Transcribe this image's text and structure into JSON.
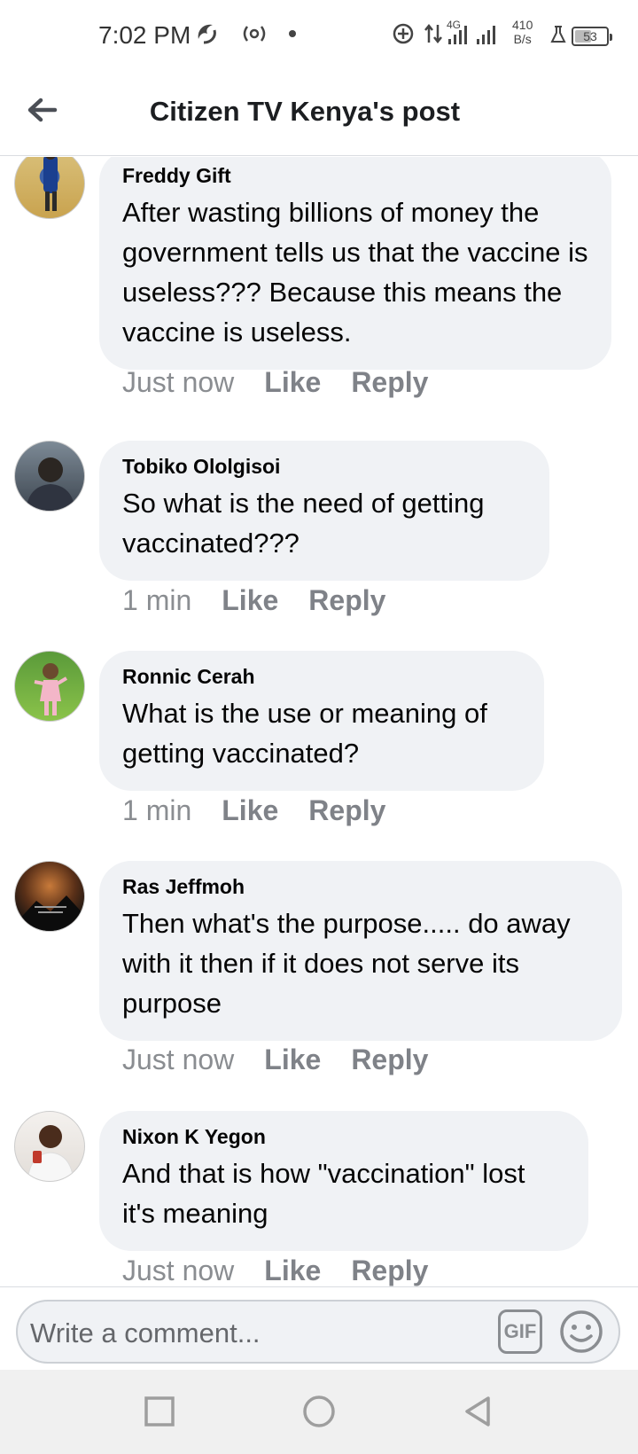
{
  "status_bar": {
    "time": "7:02 PM",
    "network_label": "4G",
    "speed_value": "410",
    "speed_unit": "B/s",
    "battery": "53",
    "battery_fraction": 0.53
  },
  "header": {
    "title": "Citizen TV Kenya's post"
  },
  "comments": [
    {
      "author": "Freddy Gift",
      "text": "After wasting billions of money the government tells us that the vaccine is useless??? Because this means the vaccine is useless.",
      "time": "Just now",
      "like_label": "Like",
      "reply_label": "Reply"
    },
    {
      "author": "Tobiko Ololgisoi",
      "text": "So what is the need of getting vaccinated???",
      "time": "1 min",
      "like_label": "Like",
      "reply_label": "Reply"
    },
    {
      "author": "Ronnic Cerah",
      "text": "What is the use or meaning of getting vaccinated?",
      "time": "1 min",
      "like_label": "Like",
      "reply_label": "Reply"
    },
    {
      "author": "Ras Jeffmoh",
      "text": "Then what's the purpose..... do away with it then if it does not serve its purpose",
      "time": "Just now",
      "like_label": "Like",
      "reply_label": "Reply"
    },
    {
      "author": "Nixon K Yegon",
      "text": "And that is how \"vaccination\" lost it's meaning",
      "time": "Just now",
      "like_label": "Like",
      "reply_label": "Reply"
    }
  ],
  "composer": {
    "placeholder": "Write a comment...",
    "gif_label": "GIF"
  },
  "icons": {
    "back": "arrow-left-icon",
    "emoji": "smiley-icon",
    "nav_recents": "square-icon",
    "nav_home": "circle-icon",
    "nav_back": "triangle-icon"
  },
  "colors": {
    "bubble": "#f0f2f5",
    "meta_text": "#8a8d91",
    "title_text": "#1c1e21"
  }
}
